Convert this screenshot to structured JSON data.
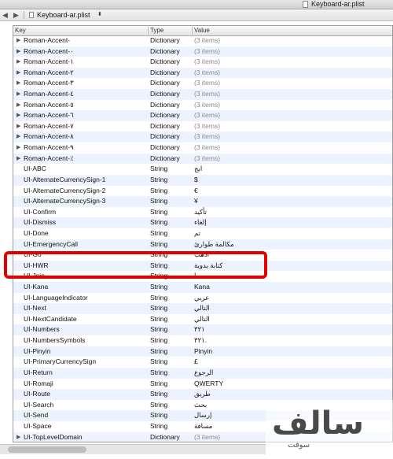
{
  "window": {
    "title": "Keyboard-ar.plist"
  },
  "pathbar": {
    "back": "◀",
    "forward": "▶",
    "file": "Keyboard-ar.plist",
    "chevron": "⬍"
  },
  "columns": {
    "key": "Key",
    "type": "Type",
    "value": "Value"
  },
  "rows": [
    {
      "expandable": true,
      "key": "Roman-Accent-",
      "type": "Dictionary",
      "value": "(3 items)"
    },
    {
      "expandable": true,
      "key": "Roman-Accent-٠",
      "type": "Dictionary",
      "value": "(3 items)"
    },
    {
      "expandable": true,
      "key": "Roman-Accent-١",
      "type": "Dictionary",
      "value": "(3 items)"
    },
    {
      "expandable": true,
      "key": "Roman-Accent-٢",
      "type": "Dictionary",
      "value": "(3 items)"
    },
    {
      "expandable": true,
      "key": "Roman-Accent-٣",
      "type": "Dictionary",
      "value": "(3 items)"
    },
    {
      "expandable": true,
      "key": "Roman-Accent-٤",
      "type": "Dictionary",
      "value": "(3 items)"
    },
    {
      "expandable": true,
      "key": "Roman-Accent-٥",
      "type": "Dictionary",
      "value": "(3 items)"
    },
    {
      "expandable": true,
      "key": "Roman-Accent-٦",
      "type": "Dictionary",
      "value": "(3 items)"
    },
    {
      "expandable": true,
      "key": "Roman-Accent-٧",
      "type": "Dictionary",
      "value": "(3 items)"
    },
    {
      "expandable": true,
      "key": "Roman-Accent-٨",
      "type": "Dictionary",
      "value": "(3 items)"
    },
    {
      "expandable": true,
      "key": "Roman-Accent-٩",
      "type": "Dictionary",
      "value": "(3 items)"
    },
    {
      "expandable": true,
      "key": "Roman-Accent-٪",
      "type": "Dictionary",
      "value": "(3 items)"
    },
    {
      "expandable": false,
      "key": "UI-ABC",
      "type": "String",
      "value": "ابج"
    },
    {
      "expandable": false,
      "key": "UI-AlternateCurrencySign-1",
      "type": "String",
      "value": "$"
    },
    {
      "expandable": false,
      "key": "UI-AlternateCurrencySign-2",
      "type": "String",
      "value": "€"
    },
    {
      "expandable": false,
      "key": "UI-AlternateCurrencySign-3",
      "type": "String",
      "value": "¥"
    },
    {
      "expandable": false,
      "key": "UI-Confirm",
      "type": "String",
      "value": "تأكيد"
    },
    {
      "expandable": false,
      "key": "UI-Dismiss",
      "type": "String",
      "value": "إلغاء"
    },
    {
      "expandable": false,
      "key": "UI-Done",
      "type": "String",
      "value": "تم"
    },
    {
      "expandable": false,
      "key": "UI-EmergencyCall",
      "type": "String",
      "value": "مكالمة طوارئ"
    },
    {
      "expandable": false,
      "key": "UI-Go",
      "type": "String",
      "value": "اذهب"
    },
    {
      "expandable": false,
      "key": "UI-HWR",
      "type": "String",
      "value": "كتابة يدوية"
    },
    {
      "expandable": false,
      "key": "UI-Join",
      "type": "String",
      "value": "ا"
    },
    {
      "expandable": false,
      "key": "UI-Kana",
      "type": "String",
      "value": "Kana"
    },
    {
      "expandable": false,
      "key": "UI-LanguageIndicator",
      "type": "String",
      "value": "عربي"
    },
    {
      "expandable": false,
      "key": "UI-Next",
      "type": "String",
      "value": "التالي"
    },
    {
      "expandable": false,
      "key": "UI-NextCandidate",
      "type": "String",
      "value": "التالي"
    },
    {
      "expandable": false,
      "key": "UI-Numbers",
      "type": "String",
      "value": "٣٢١"
    },
    {
      "expandable": false,
      "key": "UI-NumbersSymbols",
      "type": "String",
      "value": "٣٢١."
    },
    {
      "expandable": false,
      "key": "UI-Pinyin",
      "type": "String",
      "value": "Pinyin"
    },
    {
      "expandable": false,
      "key": "UI-PrimaryCurrencySign",
      "type": "String",
      "value": "£"
    },
    {
      "expandable": false,
      "key": "UI-Return",
      "type": "String",
      "value": "الرجوع"
    },
    {
      "expandable": false,
      "key": "UI-Romaji",
      "type": "String",
      "value": "QWERTY"
    },
    {
      "expandable": false,
      "key": "UI-Route",
      "type": "String",
      "value": "طريق"
    },
    {
      "expandable": false,
      "key": "UI-Search",
      "type": "String",
      "value": "بحث"
    },
    {
      "expandable": false,
      "key": "UI-Send",
      "type": "String",
      "value": "إرسال"
    },
    {
      "expandable": false,
      "key": "UI-Space",
      "type": "String",
      "value": "مسافة"
    },
    {
      "expandable": true,
      "key": "UI-TopLevelDomain",
      "type": "Dictionary",
      "value": "(3 items)"
    }
  ],
  "highlight": {
    "color": "#e00000"
  },
  "watermark": {
    "main": "سالف",
    "sub": "سوفت"
  }
}
